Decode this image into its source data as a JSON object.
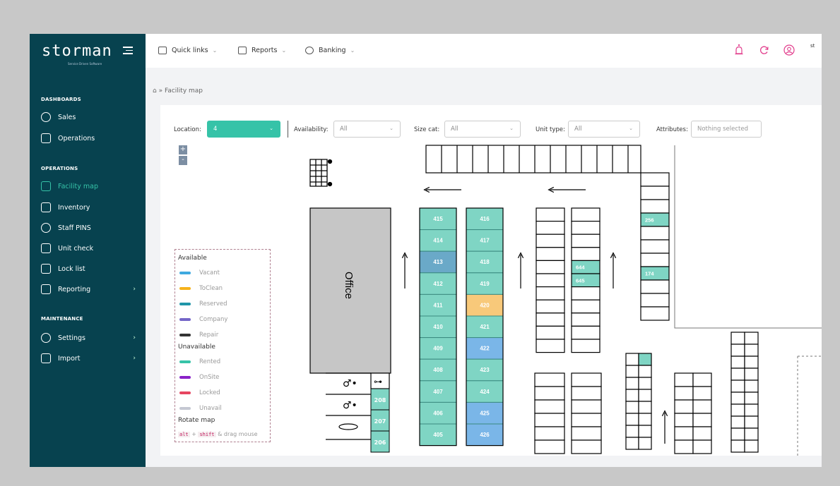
{
  "brand": {
    "logo": "storman",
    "tagline": "Service Driven Software"
  },
  "topbar": {
    "quick_links": "Quick links",
    "reports": "Reports",
    "banking": "Banking",
    "user_initial": "st"
  },
  "sidebar": {
    "dashboards_label": "DASHBOARDS",
    "operations_label": "OPERATIONS",
    "maintenance_label": "MAINTENANCE",
    "items": [
      {
        "label": "Sales",
        "icon": "sales-icon"
      },
      {
        "label": "Operations",
        "icon": "operations-icon"
      },
      {
        "label": "Facility map",
        "icon": "facility-map-icon",
        "active": true
      },
      {
        "label": "Inventory",
        "icon": "inventory-icon"
      },
      {
        "label": "Staff PINS",
        "icon": "staff-pins-icon"
      },
      {
        "label": "Unit check",
        "icon": "unit-check-icon"
      },
      {
        "label": "Lock list",
        "icon": "lock-icon"
      },
      {
        "label": "Reporting",
        "icon": "reporting-icon",
        "has_submenu": true
      },
      {
        "label": "Settings",
        "icon": "settings-icon",
        "has_submenu": true
      },
      {
        "label": "Import",
        "icon": "import-icon",
        "has_submenu": true
      }
    ]
  },
  "breadcrumb": {
    "home_icon": "home-icon",
    "separator": "»",
    "page": "Facility map"
  },
  "filters": {
    "location_label": "Location:",
    "location_value": "4",
    "availability_label": "Availability:",
    "availability_value": "All",
    "size_label": "Size cat:",
    "size_value": "All",
    "unit_type_label": "Unit type:",
    "unit_type_value": "All",
    "attributes_label": "Attributes:",
    "attributes_value": "Nothing selected"
  },
  "zoom": {
    "plus": "+",
    "minus": "-"
  },
  "legend": {
    "available_title": "Available",
    "available": [
      {
        "label": "Vacant",
        "color": "#3fa9e0"
      },
      {
        "label": "ToClean",
        "color": "#f6b21b"
      },
      {
        "label": "Reserved",
        "color": "#1f95a8"
      },
      {
        "label": "Company",
        "color": "#7466c8"
      },
      {
        "label": "Repair",
        "color": "#333333"
      }
    ],
    "unavailable_title": "Unavailable",
    "unavailable": [
      {
        "label": "Rented",
        "color": "#36c3a8"
      },
      {
        "label": "OnSite",
        "color": "#8a22c8"
      },
      {
        "label": "Locked",
        "color": "#e64660"
      },
      {
        "label": "Unavail",
        "color": "#c5c8d2"
      }
    ],
    "rotate_title": "Rotate map",
    "rotate_key1": "alt",
    "rotate_plus": "+",
    "rotate_key2": "shift",
    "rotate_suffix": "& drag mouse"
  },
  "map": {
    "office_label": "Office",
    "colors": {
      "rented": "#7fd5c4",
      "vacant_blue": "#7ab6e8",
      "reserved": "#6aa9c8",
      "toclean": "#f8c97a",
      "rented_dark": "#36c3a8"
    },
    "col_a": [
      {
        "label": "415",
        "status": "rented"
      },
      {
        "label": "414",
        "status": "rented"
      },
      {
        "label": "413",
        "status": "reserved"
      },
      {
        "label": "412",
        "status": "rented"
      },
      {
        "label": "411",
        "status": "rented"
      },
      {
        "label": "410",
        "status": "rented"
      },
      {
        "label": "409",
        "status": "rented"
      },
      {
        "label": "408",
        "status": "rented"
      },
      {
        "label": "407",
        "status": "rented"
      },
      {
        "label": "406",
        "status": "rented"
      },
      {
        "label": "405",
        "status": "rented"
      }
    ],
    "col_b": [
      {
        "label": "416",
        "status": "rented"
      },
      {
        "label": "417",
        "status": "rented"
      },
      {
        "label": "418",
        "status": "rented"
      },
      {
        "label": "419",
        "status": "rented"
      },
      {
        "label": "420",
        "status": "toclean"
      },
      {
        "label": "421",
        "status": "rented"
      },
      {
        "label": "422",
        "status": "vacant_blue"
      },
      {
        "label": "423",
        "status": "rented"
      },
      {
        "label": "424",
        "status": "rented"
      },
      {
        "label": "425",
        "status": "vacant_blue"
      },
      {
        "label": "426",
        "status": "vacant_blue"
      }
    ],
    "col_c_labels": [
      "644",
      "645"
    ],
    "col_d_labels": [
      "256",
      "174"
    ],
    "small_units": [
      "208",
      "207",
      "206"
    ]
  }
}
